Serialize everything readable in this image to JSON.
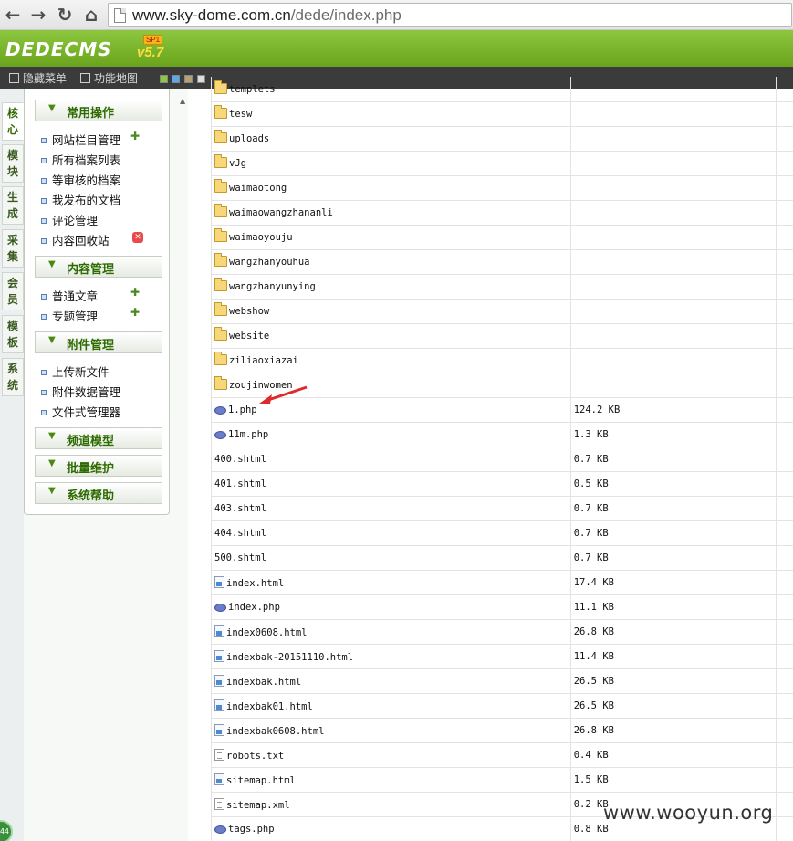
{
  "browser": {
    "url_host": "www.sky-dome.com.cn",
    "url_path": "/dede/index.php"
  },
  "cms": {
    "logo": "DEDECMS",
    "badge": "SP1",
    "version": "v5.7"
  },
  "toolbar": {
    "hide_menu": "隐藏菜单",
    "site_map": "功能地图",
    "theme_colors": [
      "#8dc63f",
      "#5aa9e6",
      "#b3a276",
      "#dddddd"
    ]
  },
  "vtabs": [
    {
      "label": "核心",
      "active": true
    },
    {
      "label": "模块"
    },
    {
      "label": "生成"
    },
    {
      "label": "采集"
    },
    {
      "label": "会员"
    },
    {
      "label": "模板"
    },
    {
      "label": "系统"
    }
  ],
  "sidebar": {
    "sections": [
      {
        "title": "常用操作",
        "items": [
          "网站栏目管理",
          "所有档案列表",
          "等审核的档案",
          "我发布的文档",
          "评论管理",
          "内容回收站"
        ]
      },
      {
        "title": "内容管理",
        "items": [
          "普通文章",
          "专题管理"
        ]
      },
      {
        "title": "附件管理",
        "items": [
          "上传新文件",
          "附件数据管理",
          "文件式管理器"
        ]
      },
      {
        "title": "频道模型",
        "items": []
      },
      {
        "title": "批量维护",
        "items": []
      },
      {
        "title": "系统帮助",
        "items": []
      }
    ]
  },
  "files": [
    {
      "name": "templets",
      "size": "",
      "icon": "folder"
    },
    {
      "name": "tesw",
      "size": "",
      "icon": "folder"
    },
    {
      "name": "uploads",
      "size": "",
      "icon": "folder"
    },
    {
      "name": "vJg",
      "size": "",
      "icon": "folder"
    },
    {
      "name": "waimaotong",
      "size": "",
      "icon": "folder"
    },
    {
      "name": "waimaowangzhananli",
      "size": "",
      "icon": "folder"
    },
    {
      "name": "waimaoyouju",
      "size": "",
      "icon": "folder"
    },
    {
      "name": "wangzhanyouhua",
      "size": "",
      "icon": "folder"
    },
    {
      "name": "wangzhanyunying",
      "size": "",
      "icon": "folder"
    },
    {
      "name": "webshow",
      "size": "",
      "icon": "folder"
    },
    {
      "name": "website",
      "size": "",
      "icon": "folder"
    },
    {
      "name": "ziliaoxiazai",
      "size": "",
      "icon": "folder"
    },
    {
      "name": "zoujinwomen",
      "size": "",
      "icon": "folder"
    },
    {
      "name": "1.php",
      "size": "124.2 KB",
      "icon": "php"
    },
    {
      "name": "11m.php",
      "size": "1.3 KB",
      "icon": "php"
    },
    {
      "name": "400.shtml",
      "size": "0.7 KB",
      "icon": "none"
    },
    {
      "name": "401.shtml",
      "size": "0.5 KB",
      "icon": "none"
    },
    {
      "name": "403.shtml",
      "size": "0.7 KB",
      "icon": "none"
    },
    {
      "name": "404.shtml",
      "size": "0.7 KB",
      "icon": "none"
    },
    {
      "name": "500.shtml",
      "size": "0.7 KB",
      "icon": "none"
    },
    {
      "name": "index.html",
      "size": "17.4 KB",
      "icon": "html"
    },
    {
      "name": "index.php",
      "size": "11.1 KB",
      "icon": "php"
    },
    {
      "name": "index0608.html",
      "size": "26.8 KB",
      "icon": "html"
    },
    {
      "name": "indexbak-20151110.html",
      "size": "11.4 KB",
      "icon": "html"
    },
    {
      "name": "indexbak.html",
      "size": "26.5 KB",
      "icon": "html"
    },
    {
      "name": "indexbak01.html",
      "size": "26.5 KB",
      "icon": "html"
    },
    {
      "name": "indexbak0608.html",
      "size": "26.8 KB",
      "icon": "html"
    },
    {
      "name": "robots.txt",
      "size": "0.4 KB",
      "icon": "txt"
    },
    {
      "name": "sitemap.html",
      "size": "1.5 KB",
      "icon": "html"
    },
    {
      "name": "sitemap.xml",
      "size": "0.2 KB",
      "icon": "txt"
    },
    {
      "name": "tags.php",
      "size": "0.8 KB",
      "icon": "php"
    }
  ],
  "watermark": "www.wooyun.org",
  "status_badge": "44"
}
